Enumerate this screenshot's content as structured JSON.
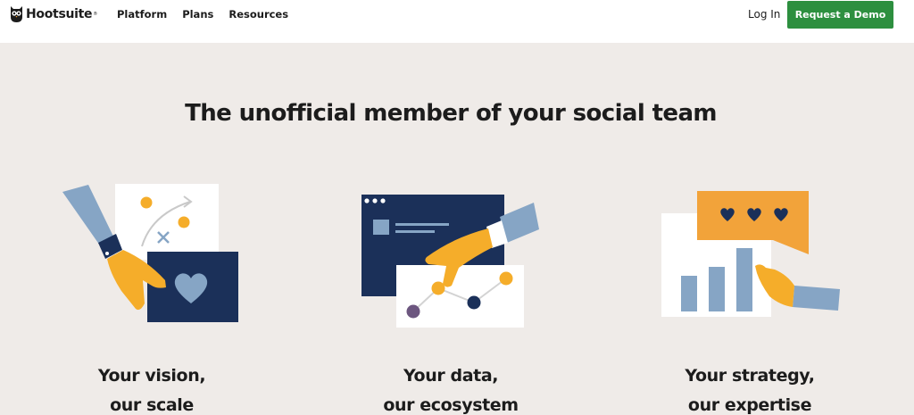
{
  "brand": {
    "name": "Hootsuite",
    "reg_mark": "®"
  },
  "nav": {
    "links": [
      {
        "label": "Platform"
      },
      {
        "label": "Plans"
      },
      {
        "label": "Resources"
      }
    ],
    "login_label": "Log In",
    "demo_label": "Request a Demo"
  },
  "hero": {
    "headline": "The unofficial member of your social team"
  },
  "cards": [
    {
      "line1": "Your vision,",
      "line2": "our scale"
    },
    {
      "line1": "Your data,",
      "line2": "our ecosystem"
    },
    {
      "line1": "Your strategy,",
      "line2": "our expertise"
    }
  ],
  "colors": {
    "background": "#efebe8",
    "cta_green": "#2d8f3f",
    "navy": "#1b3059",
    "sleeve_blue": "#86a5c5",
    "hand_yellow": "#f5ad2a",
    "card_orange": "#f2a33a",
    "dot_purple": "#6c567f"
  }
}
